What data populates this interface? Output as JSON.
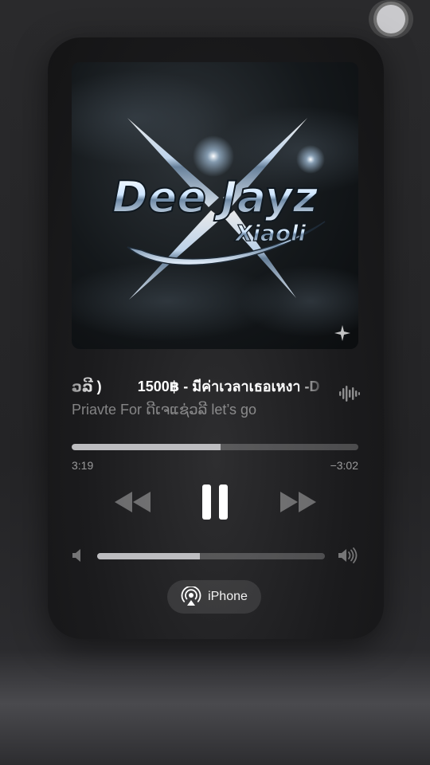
{
  "now_playing": {
    "title_trailing_fragment": "ວລີ )",
    "title": "1500฿ - มีค่าเวลาเธอเหงา -D",
    "artist": "Priavte For ດີເຈແຊ່ວລີ let’s go",
    "artwork": {
      "logo_line1": "Dee Jayz",
      "logo_line2": "Xiaoli",
      "sparkle_icon": "sparkle-icon"
    },
    "progress_fraction": 0.52,
    "elapsed": "3:19",
    "remaining": "−3:02"
  },
  "controls": {
    "rewind_icon": "rewind-icon",
    "pause_icon": "pause-icon",
    "forward_icon": "fast-forward-icon"
  },
  "volume": {
    "level_fraction": 0.45,
    "low_icon": "speaker-low-icon",
    "high_icon": "speaker-high-icon"
  },
  "output": {
    "device_label": "iPhone",
    "icon": "airplay-audio-icon"
  },
  "colors": {
    "panel": "#1b1b1d",
    "track": "#5a5a5e",
    "fill": "#bdbdc0",
    "secondary_text": "#8c8c8f"
  }
}
